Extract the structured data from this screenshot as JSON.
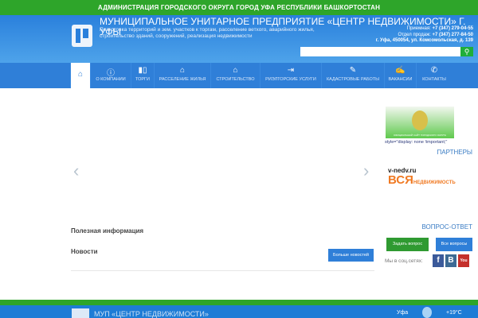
{
  "topbar": "АДМИНИСТРАЦИЯ ГОРОДСКОГО ОКРУГА ГОРОД УФА РЕСПУБЛИКИ БАШКОРТОСТАН",
  "header": {
    "title": "МУНИЦИПАЛЬНОЕ УНИТАРНОЕ ПРЕДПРИЯТИЕ «ЦЕНТР НЕДВИЖИМОСТИ» Г. УФЫ",
    "subtitle": "Подготовка территорий и зем. участков к торгам, расселение ветхого, аварийного жилья, строительство зданий, сооружений, реализация недвижимости",
    "phone1_label": "Приемная:",
    "phone1": "+7 (347) 279-04-55",
    "phone2_label": "Отдел продаж:",
    "phone2": "+7 (347) 277-84-50",
    "address": "г. Уфа, 450054, ул. Комсомольская, д. 139"
  },
  "search": {
    "placeholder": "",
    "icon": "search-icon"
  },
  "nav": [
    {
      "label": "",
      "icon": "home-icon",
      "g": "⌂"
    },
    {
      "label": "О КОМПАНИИ",
      "icon": "info-icon",
      "g": "ⓘ"
    },
    {
      "label": "ТОРГИ",
      "icon": "auction-icon",
      "g": "▮▯"
    },
    {
      "label": "РАССЕЛЕНИЕ ЖИЛЬЯ",
      "icon": "house-gear-icon",
      "g": "⌂"
    },
    {
      "label": "СТРОИТЕЛЬСТВО",
      "icon": "house-icon",
      "g": "⌂"
    },
    {
      "label": "РИЭЛТОРСКИЕ УСЛУГИ",
      "icon": "door-icon",
      "g": "⇥"
    },
    {
      "label": "КАДАСТРОВЫЕ РАБОТЫ",
      "icon": "ruler-icon",
      "g": "✎"
    },
    {
      "label": "ВАКАНСИИ",
      "icon": "handshake-icon",
      "g": "✍"
    },
    {
      "label": "КОНТАКТЫ",
      "icon": "phone-icon",
      "g": "✆"
    }
  ],
  "slider": {
    "prev": "‹",
    "next": "›"
  },
  "sidebar": {
    "banner_caption": "ОФИЦИАЛЬНЫЙ САЙТ ГОРОДСКОГО ОКРУГА",
    "style_note": "style=\"display: none !important;\"",
    "partners": "ПАРТНЕРЫ",
    "partner_url": "v-nedv.ru",
    "partner_big": "ВСЯ",
    "partner_small": "НЕДВИЖИМОСТЬ",
    "qa": "ВОПРОС-ОТВЕТ",
    "ask": "Задать вопрос",
    "all": "Все вопросы",
    "social": "Мы в соц.сетях:",
    "fb": "f",
    "vk": "B",
    "yt": "You"
  },
  "main": {
    "useful": "Полезная информация",
    "news": "Новости",
    "more_news": "Больше новостей"
  },
  "footer": {
    "title": "МУП «ЦЕНТР НЕДВИЖИМОСТИ»",
    "city": "Уфа",
    "temp": "+19°C"
  }
}
